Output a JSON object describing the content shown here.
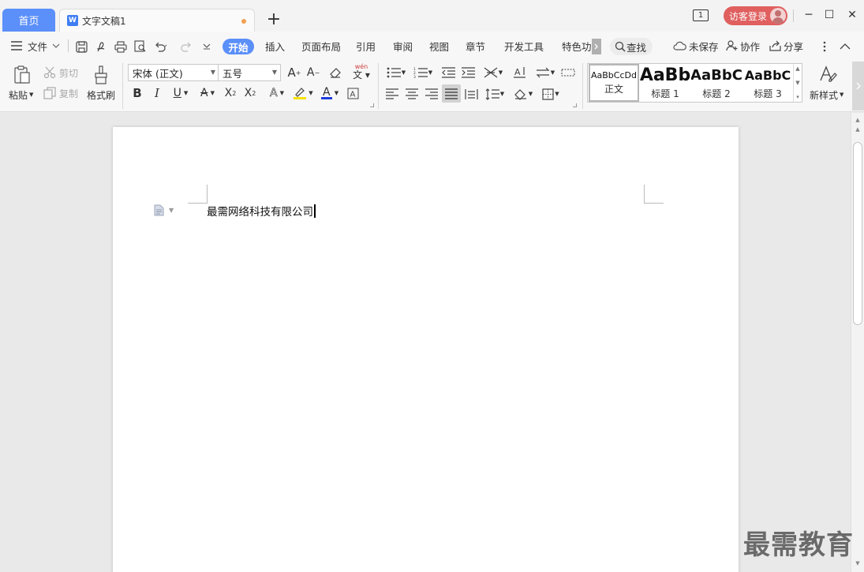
{
  "tabs": {
    "home_label": "首页",
    "doc_icon": "W",
    "doc_label": "文字文稿1",
    "add_label": "+"
  },
  "window": {
    "count": "1",
    "login_label": "访客登录",
    "minimize": "─",
    "maximize": "☐",
    "close": "✕"
  },
  "menu": {
    "file": "文件",
    "tabs": [
      "开始",
      "插入",
      "页面布局",
      "引用",
      "审阅",
      "视图",
      "章节",
      "开发工具",
      "特色功"
    ],
    "search": "查找",
    "unsaved": "未保存",
    "collab": "协作",
    "share": "分享"
  },
  "ribbon": {
    "paste": "粘贴",
    "cut": "剪切",
    "copy": "复制",
    "format_painter": "格式刷",
    "font_name": "宋体 (正文)",
    "font_size": "五号",
    "phonetic": "wén",
    "new_style": "新样式",
    "styles": [
      {
        "preview": "AaBbCcDd",
        "label": "正文"
      },
      {
        "preview": "AaBb",
        "label": "标题 1"
      },
      {
        "preview": "AaBbC",
        "label": "标题 2"
      },
      {
        "preview": "AaBbC",
        "label": "标题 3"
      }
    ]
  },
  "document": {
    "text": "最需网络科技有限公司"
  },
  "watermark": "最需教育",
  "colors": {
    "accent": "#5b8ff9",
    "login": "#e05f5f",
    "highlight": "#f5e100",
    "font_color": "#1e3cdc",
    "clear_red": "#d04040"
  }
}
